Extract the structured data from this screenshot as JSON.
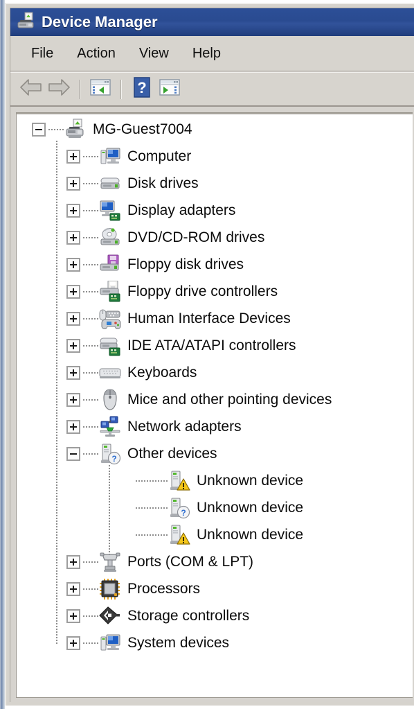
{
  "window": {
    "title": "Device Manager",
    "title_icon": "device-manager-icon",
    "titlebar_color": "#2a4b91"
  },
  "menubar": {
    "items": [
      {
        "label": "File",
        "name": "menu-file"
      },
      {
        "label": "Action",
        "name": "menu-action"
      },
      {
        "label": "View",
        "name": "menu-view"
      },
      {
        "label": "Help",
        "name": "menu-help"
      }
    ]
  },
  "toolbar": {
    "buttons": [
      {
        "name": "back-button",
        "icon": "back-arrow-icon",
        "label": "Back"
      },
      {
        "name": "forward-button",
        "icon": "forward-arrow-icon",
        "label": "Forward"
      },
      {
        "name": "show-hide-tree-button",
        "icon": "show-console-tree-icon",
        "label": "Show/Hide Console Tree"
      },
      {
        "name": "help-button",
        "icon": "help-question-icon",
        "label": "Help"
      },
      {
        "name": "properties-button",
        "icon": "show-action-pane-icon",
        "label": "Show/Hide Action Pane"
      }
    ]
  },
  "tree": {
    "root": {
      "label": "MG-Guest7004",
      "icon": "computer-host-icon",
      "expanded": true,
      "level": 0
    },
    "items": [
      {
        "label": "Computer",
        "icon": "computer-icon",
        "state": "collapsed",
        "level": 1
      },
      {
        "label": "Disk drives",
        "icon": "disk-drive-icon",
        "state": "collapsed",
        "level": 1
      },
      {
        "label": "Display adapters",
        "icon": "display-adapter-icon",
        "state": "collapsed",
        "level": 1
      },
      {
        "label": "DVD/CD-ROM drives",
        "icon": "dvd-cdrom-icon",
        "state": "collapsed",
        "level": 1
      },
      {
        "label": "Floppy disk drives",
        "icon": "floppy-disk-drive-icon",
        "state": "collapsed",
        "level": 1
      },
      {
        "label": "Floppy drive controllers",
        "icon": "floppy-controller-icon",
        "state": "collapsed",
        "level": 1
      },
      {
        "label": "Human Interface Devices",
        "icon": "hid-icon",
        "state": "collapsed",
        "level": 1
      },
      {
        "label": "IDE ATA/ATAPI controllers",
        "icon": "ide-controller-icon",
        "state": "collapsed",
        "level": 1
      },
      {
        "label": "Keyboards",
        "icon": "keyboard-icon",
        "state": "collapsed",
        "level": 1
      },
      {
        "label": "Mice and other pointing devices",
        "icon": "mouse-icon",
        "state": "collapsed",
        "level": 1
      },
      {
        "label": "Network adapters",
        "icon": "network-adapter-icon",
        "state": "collapsed",
        "level": 1
      },
      {
        "label": "Other devices",
        "icon": "other-device-icon",
        "state": "expanded",
        "level": 1
      },
      {
        "label": "Unknown device",
        "icon": "unknown-device-warning-icon",
        "state": "leaf",
        "level": 2
      },
      {
        "label": "Unknown device",
        "icon": "unknown-device-question-icon",
        "state": "leaf",
        "level": 2
      },
      {
        "label": "Unknown device",
        "icon": "unknown-device-warning-icon",
        "state": "leaf",
        "level": 2
      },
      {
        "label": "Ports (COM & LPT)",
        "icon": "port-icon",
        "state": "collapsed",
        "level": 1
      },
      {
        "label": "Processors",
        "icon": "processor-icon",
        "state": "collapsed",
        "level": 1
      },
      {
        "label": "Storage controllers",
        "icon": "storage-controller-icon",
        "state": "collapsed",
        "level": 1
      },
      {
        "label": "System devices",
        "icon": "system-device-icon",
        "state": "collapsed",
        "level": 1
      }
    ]
  }
}
